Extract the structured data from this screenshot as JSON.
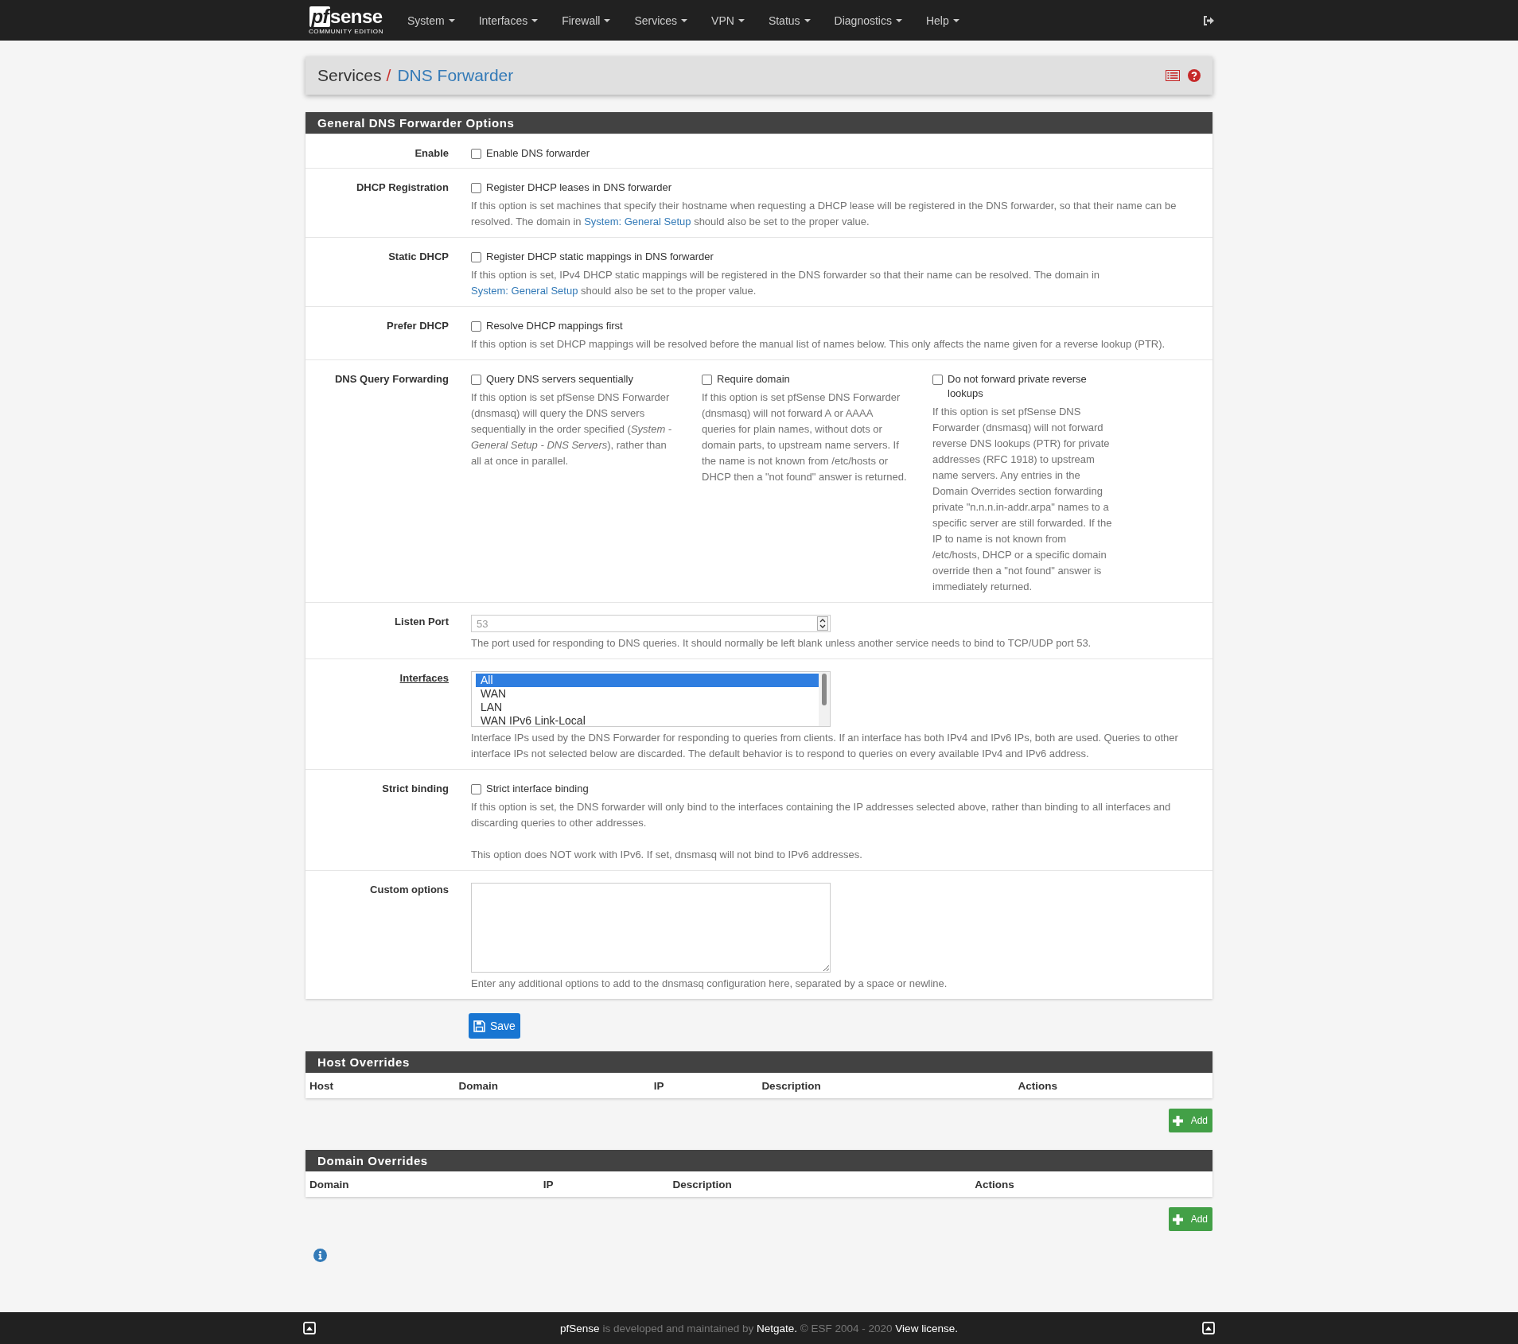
{
  "navbar": {
    "logo_left": "pf",
    "logo_right": "sense",
    "tagline": "COMMUNITY EDITION",
    "menus": [
      "System",
      "Interfaces",
      "Firewall",
      "Services",
      "VPN",
      "Status",
      "Diagnostics",
      "Help"
    ]
  },
  "breadcrumb": {
    "parent": "Services",
    "separator": "/",
    "current": "DNS Forwarder"
  },
  "options": {
    "title": "General DNS Forwarder Options",
    "rows": [
      {
        "kind": "checkbox",
        "label": "Enable",
        "checkbox": {
          "label": "Enable DNS forwarder",
          "checked": false
        }
      },
      {
        "kind": "checkbox",
        "label": "DHCP Registration",
        "checkbox": {
          "label": "Register DHCP leases in DNS forwarder",
          "checked": false
        },
        "help": [
          [
            {
              "text": "If this option is set machines that specify their hostname when requesting a DHCP lease will be registered in the DNS forwarder, so that their name can be resolved. The domain in "
            },
            {
              "link": "System: General Setup"
            },
            {
              "text": " should also be set to the proper value."
            }
          ]
        ]
      },
      {
        "kind": "checkbox",
        "label": "Static DHCP",
        "checkbox": {
          "label": "Register DHCP static mappings in DNS forwarder",
          "checked": false
        },
        "help": [
          [
            {
              "text": "If this option is set, IPv4 DHCP static mappings will be registered in the DNS forwarder so that their name can be resolved. The domain in "
            },
            {
              "link": "System: General Setup"
            },
            {
              "text": " should also be set to the proper value."
            }
          ]
        ]
      },
      {
        "kind": "checkbox",
        "label": "Prefer DHCP",
        "checkbox": {
          "label": "Resolve DHCP mappings first",
          "checked": false
        },
        "help": [
          [
            {
              "text": "If this option is set DHCP mappings will be resolved before the manual list of names below. This only affects the name given for a reverse lookup (PTR)."
            }
          ]
        ]
      },
      {
        "kind": "multi_checkbox",
        "label": "DNS Query Forwarding",
        "options": [
          {
            "label": "Query DNS servers sequentially",
            "checked": false,
            "help": "If this option is set pfSense DNS Forwarder (dnsmasq) will query the DNS servers sequentially in the order specified (*System - General Setup - DNS Servers*), rather than all at once in parallel."
          },
          {
            "label": "Require domain",
            "checked": false,
            "help": "If this option is set pfSense DNS Forwarder (dnsmasq) will not forward A or AAAA queries for plain names, without dots or domain parts, to upstream name servers. If the name is not known from /etc/hosts or DHCP then a \"not found\" answer is returned."
          },
          {
            "label": "Do not forward private reverse lookups",
            "checked": false,
            "help": "If this option is set pfSense DNS Forwarder (dnsmasq) will not forward reverse DNS lookups (PTR) for private addresses (RFC 1918) to upstream name servers. Any entries in the Domain Overrides section forwarding private \"n.n.n.in-addr.arpa\" names to a specific server are still forwarded. If the IP to name is not known from /etc/hosts, DHCP or a specific domain override then a \"not found\" answer is immediately returned."
          }
        ]
      },
      {
        "kind": "number",
        "label": "Listen Port",
        "placeholder": "53",
        "help": [
          [
            {
              "text": "The port used for responding to DNS queries. It should normally be left blank unless another service needs to bind to TCP/UDP port 53."
            }
          ]
        ]
      },
      {
        "kind": "select",
        "label": "Interfaces",
        "options": [
          {
            "label": "All",
            "selected": true
          },
          {
            "label": "WAN",
            "selected": false
          },
          {
            "label": "LAN",
            "selected": false
          },
          {
            "label": "WAN IPv6 Link-Local",
            "selected": false
          }
        ],
        "help": [
          [
            {
              "text": "Interface IPs used by the DNS Forwarder for responding to queries from clients. If an interface has both IPv4 and IPv6 IPs, both are used. Queries to other interface IPs not selected below are discarded. The default behavior is to respond to queries on every available IPv4 and IPv6 address."
            }
          ]
        ]
      },
      {
        "kind": "checkbox",
        "label": "Strict binding",
        "checkbox": {
          "label": "Strict interface binding",
          "checked": false
        },
        "help": [
          [
            {
              "text": "If this option is set, the DNS forwarder will only bind to the interfaces containing the IP addresses selected above, rather than binding to all interfaces and discarding queries to other addresses."
            }
          ],
          [
            {
              "text": "This option does NOT work with IPv6. If set, dnsmasq will not bind to IPv6 addresses."
            }
          ]
        ]
      },
      {
        "kind": "textarea",
        "label": "Custom options",
        "help": [
          [
            {
              "text": "Enter any additional options to add to the dnsmasq configuration here, separated by a space or newline."
            }
          ]
        ]
      }
    ]
  },
  "save_button": "Save",
  "tables": [
    {
      "title": "Host Overrides",
      "columns": [
        "Host",
        "Domain",
        "IP",
        "Description",
        "Actions"
      ],
      "add_button": "Add"
    },
    {
      "title": "Domain Overrides",
      "columns": [
        "Domain",
        "IP",
        "Description",
        "Actions"
      ],
      "add_button": "Add"
    }
  ],
  "footer": [
    {
      "kind": "link",
      "text": "pfSense"
    },
    {
      "kind": "text",
      "text": " is developed and maintained by "
    },
    {
      "kind": "link",
      "text": "Netgate."
    },
    {
      "kind": "text",
      "text": " © ESF 2004 - 2020 "
    },
    {
      "kind": "link",
      "text": "View license."
    }
  ]
}
